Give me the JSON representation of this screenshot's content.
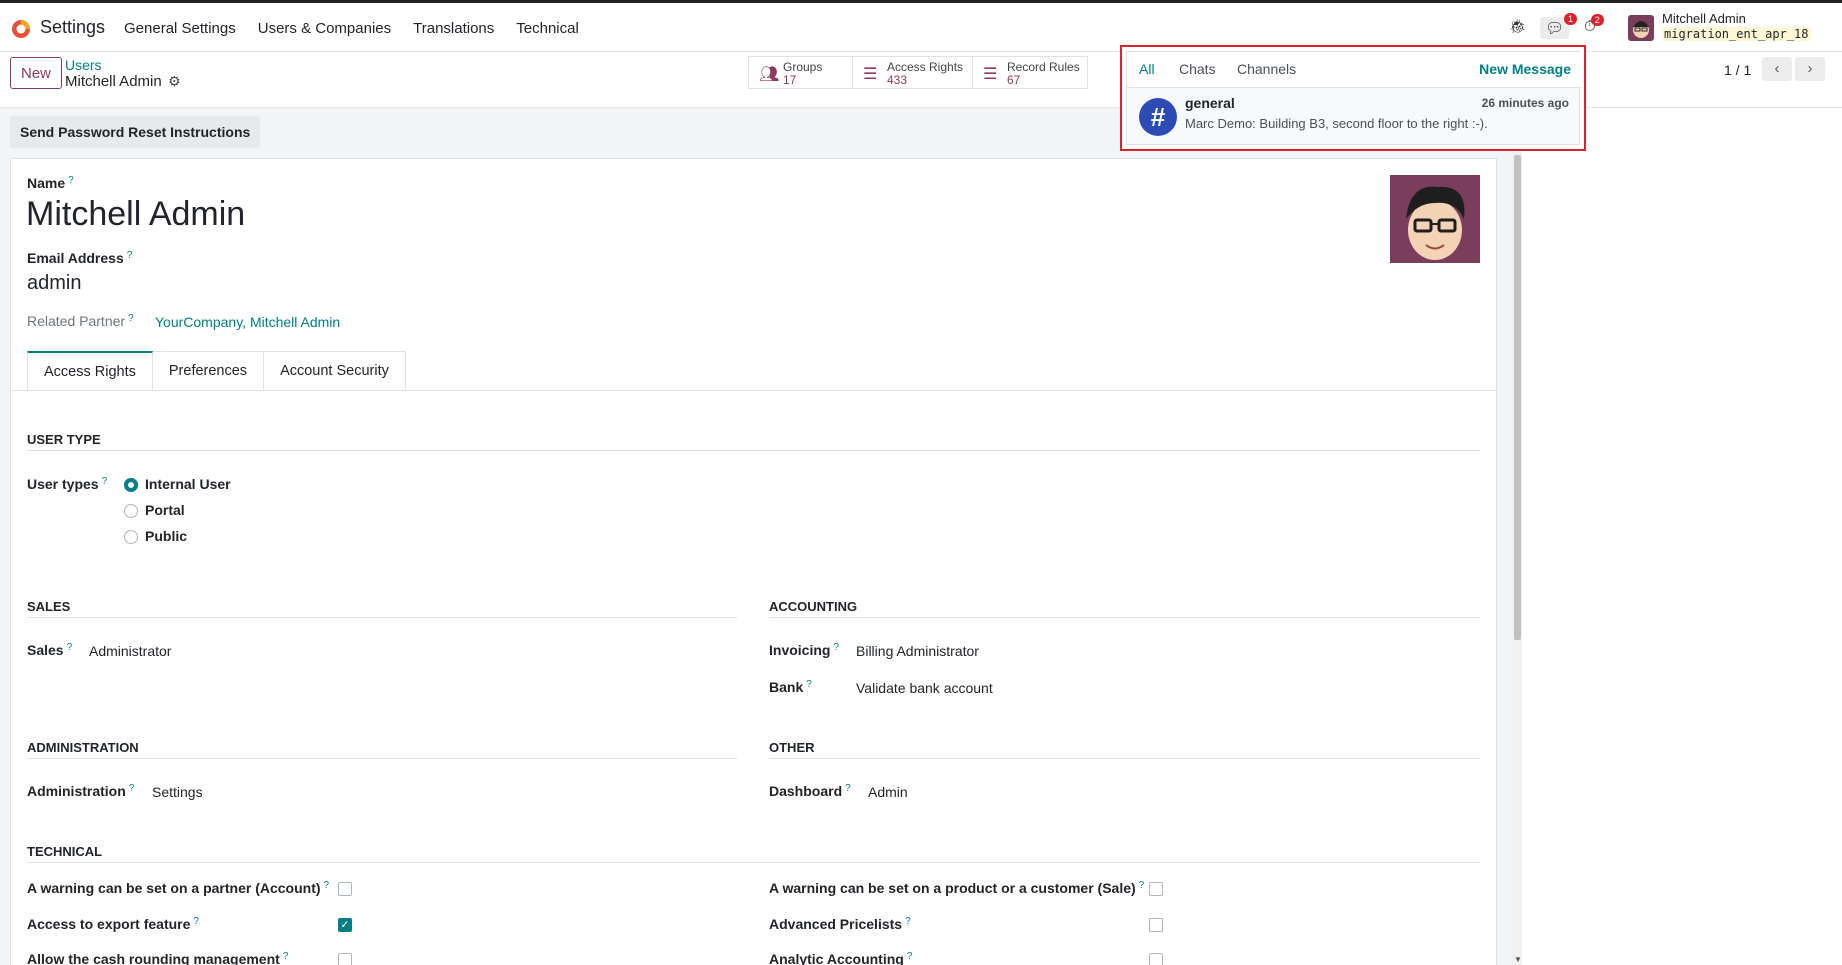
{
  "app": {
    "title": "Settings"
  },
  "menu": [
    "General Settings",
    "Users & Companies",
    "Translations",
    "Technical"
  ],
  "systray": {
    "chat_count": "1",
    "activity_count": "2",
    "user_name": "Mitchell Admin",
    "db": "migration_ent_apr_18"
  },
  "control": {
    "new_label": "New",
    "breadcrumb_parent": "Users",
    "breadcrumb_current": "Mitchell Admin",
    "smart_buttons": [
      {
        "label": "Groups",
        "value": "17"
      },
      {
        "label": "Access Rights",
        "value": "433"
      },
      {
        "label": "Record Rules",
        "value": "67"
      }
    ],
    "pager": "1 / 1"
  },
  "actions": {
    "reset_password": "Send Password Reset Instructions"
  },
  "form": {
    "name_label": "Name",
    "name": "Mitchell Admin",
    "email_label": "Email Address",
    "email": "admin",
    "partner_label": "Related Partner",
    "partner": "YourCompany, Mitchell Admin",
    "tabs": [
      "Access Rights",
      "Preferences",
      "Account Security"
    ],
    "user_type_section": "USER TYPE",
    "user_types_label": "User types",
    "user_types": [
      "Internal User",
      "Portal",
      "Public"
    ],
    "sales_section": "SALES",
    "sales_label": "Sales",
    "sales_value": "Administrator",
    "accounting_section": "ACCOUNTING",
    "invoicing_label": "Invoicing",
    "invoicing_value": "Billing Administrator",
    "bank_label": "Bank",
    "bank_value": "Validate bank account",
    "admin_section": "ADMINISTRATION",
    "admin_label": "Administration",
    "admin_value": "Settings",
    "other_section": "OTHER",
    "dashboard_label": "Dashboard",
    "dashboard_value": "Admin",
    "technical_section": "TECHNICAL",
    "tech_left": [
      "A warning can be set on a partner (Account)",
      "Access to export feature",
      "Allow the cash rounding management"
    ],
    "tech_right": [
      "A warning can be set on a product or a customer (Sale)",
      "Advanced Pricelists",
      "Analytic Accounting"
    ]
  },
  "messaging": {
    "tabs": [
      "All",
      "Chats",
      "Channels"
    ],
    "new_message": "New Message",
    "channel": "general",
    "time": "26 minutes ago",
    "preview": "Marc Demo: Building B3, second floor to the right :-)."
  },
  "colors": {
    "primary": "#017e84",
    "brand": "#8b3a62",
    "highlight": "#d9232d"
  }
}
